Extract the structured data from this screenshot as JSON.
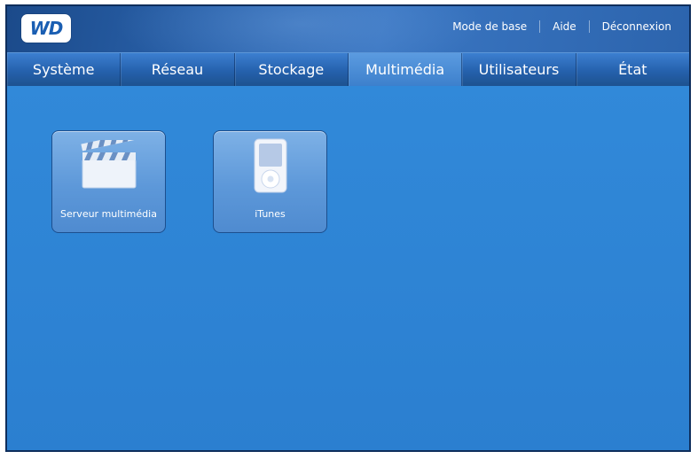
{
  "header": {
    "logo_text": "WD",
    "links": [
      "Mode de base",
      "Aide",
      "Déconnexion"
    ]
  },
  "nav": {
    "tabs": [
      "Système",
      "Réseau",
      "Stockage",
      "Multimédia",
      "Utilisateurs",
      "État"
    ],
    "active": "Multimédia"
  },
  "tiles": [
    {
      "label": "Serveur multimédia",
      "icon": "clapperboard-icon"
    },
    {
      "label": "iTunes",
      "icon": "ipod-icon"
    }
  ],
  "colors": {
    "background": "#2e82d2",
    "header": "#1b4a8a",
    "active_tab": "#4b8fd8",
    "tile": "#6aa3e0"
  }
}
